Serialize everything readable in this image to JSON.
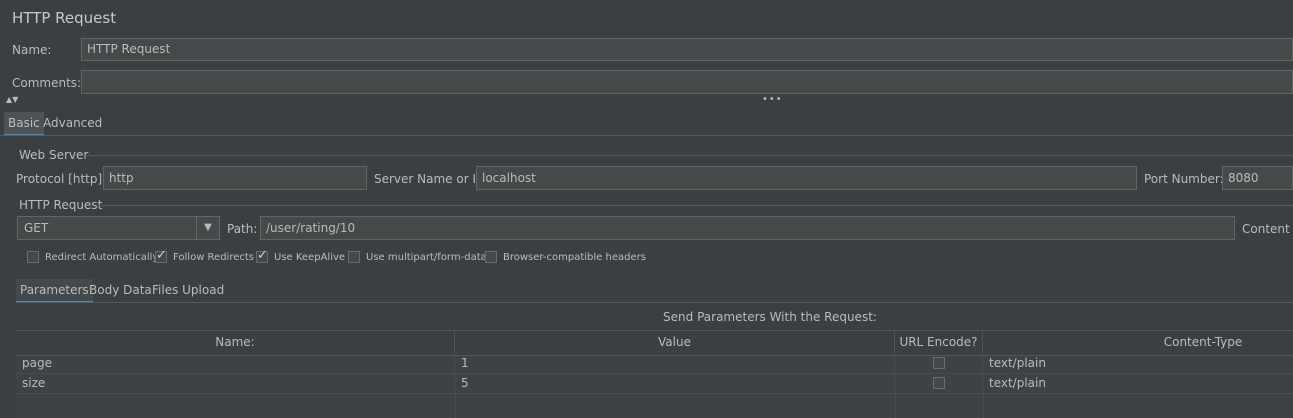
{
  "header": {
    "title": "HTTP Request",
    "name_label": "Name:",
    "name_value": "HTTP Request",
    "comments_label": "Comments:",
    "comments_value": ""
  },
  "splitter": {
    "arrows": "▲▼",
    "handle": "•••"
  },
  "tabs": [
    {
      "label": "Basic",
      "active": true
    },
    {
      "label": "Advanced",
      "active": false
    }
  ],
  "web_server": {
    "group_label": "Web Server",
    "protocol_label": "Protocol [http]:",
    "protocol_value": "http",
    "server_label": "Server Name or IP:",
    "server_value": "localhost",
    "port_label": "Port Number:",
    "port_value": "8080"
  },
  "http_request": {
    "group_label": "HTTP Request",
    "method": "GET",
    "path_label": "Path:",
    "path_value": "/user/rating/10",
    "content_encoding_label": "Content e"
  },
  "options": [
    {
      "label": "Redirect Automatically",
      "checked": false
    },
    {
      "label": "Follow Redirects",
      "checked": true
    },
    {
      "label": "Use KeepAlive",
      "checked": true
    },
    {
      "label": "Use multipart/form-data",
      "checked": false
    },
    {
      "label": "Browser-compatible headers",
      "checked": false
    }
  ],
  "subtabs": [
    {
      "label": "Parameters",
      "active": true
    },
    {
      "label": "Body Data",
      "active": false
    },
    {
      "label": "Files Upload",
      "active": false
    }
  ],
  "params": {
    "title": "Send Parameters With the Request:",
    "columns": [
      "Name:",
      "Value",
      "URL Encode?",
      "Content-Type"
    ],
    "rows": [
      {
        "name": "page",
        "value": "1",
        "encode": false,
        "content_type": "text/plain"
      },
      {
        "name": "size",
        "value": "5",
        "encode": false,
        "content_type": "text/plain"
      }
    ]
  },
  "colors": {
    "background": "#3c3f41",
    "field": "#45494a",
    "accent": "#4a88c7"
  }
}
